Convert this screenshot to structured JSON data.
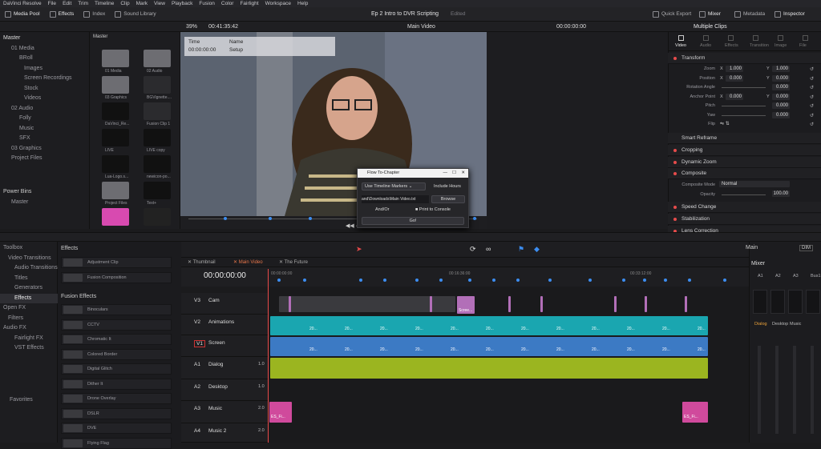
{
  "menubar": [
    "DaVinci Resolve",
    "File",
    "Edit",
    "Trim",
    "Timeline",
    "Clip",
    "Mark",
    "View",
    "Playback",
    "Fusion",
    "Color",
    "Fairlight",
    "Workspace",
    "Help"
  ],
  "toolbar": {
    "media_pool": "Media Pool",
    "effects": "Effects",
    "index": "Index",
    "sound_library": "Sound Library",
    "project_title": "Ep 2 Intro to DVR Scripting",
    "project_status": "Edited",
    "quick_export": "Quick Export",
    "mixer": "Mixer",
    "metadata": "Metadata",
    "inspector": "Inspector"
  },
  "viewer_bar": {
    "zoom": "39%",
    "timecode": "00:41:35:42",
    "viewer_name": "Main Video",
    "playhead_tc": "00:00:00:00",
    "inspector_title": "Multiple Clips"
  },
  "media_tree": {
    "header": "Master",
    "items": [
      "Master",
      "01 Media",
      "BRoll",
      "Images",
      "Screen Recordings",
      "Stock",
      "Videos",
      "02 Audio",
      "Folly",
      "Music",
      "SFX",
      "03 Graphics",
      "Project Files"
    ],
    "power_bins": "Power Bins",
    "power_master": "Master"
  },
  "media_thumbs": {
    "header": "Master",
    "items": [
      "01 Media",
      "02 Audio",
      "03 Graphics",
      "BGVignette....",
      "DaVinci_Re...",
      "Fusion Clip 1",
      "LIVE",
      "LIVE copy",
      "Lua-Logo.s...",
      "newicon-po...",
      "Project Files",
      "Text+"
    ]
  },
  "marker_overlay": {
    "col1": "Time",
    "col2": "Name",
    "val1": "00:00:00:00",
    "val2": "Setup"
  },
  "inspector": {
    "tabs": [
      "Video",
      "Audio",
      "Effects",
      "Transition",
      "Image",
      "File"
    ],
    "transform": "Transform",
    "zoom_label": "Zoom",
    "zoom_x": "1.000",
    "zoom_y": "1.000",
    "position_label": "Position",
    "pos_x": "0.000",
    "pos_y": "0.000",
    "rotation_label": "Rotation Angle",
    "rotation": "0.000",
    "anchor_label": "Anchor Point",
    "anchor_x": "0.000",
    "anchor_y": "0.000",
    "pitch_label": "Pitch",
    "pitch": "0.000",
    "yaw_label": "Yaw",
    "yaw": "0.000",
    "flip_label": "Flip",
    "x": "X",
    "y": "Y",
    "sections": [
      "Smart Reframe",
      "Cropping",
      "Dynamic Zoom",
      "Composite"
    ],
    "composite_mode_label": "Composite Mode",
    "composite_mode": "Normal",
    "opacity_label": "Opacity",
    "opacity": "100.00",
    "sections2": [
      "Speed Change",
      "Stabilization",
      "Lens Correction"
    ]
  },
  "dialog": {
    "title": "Flow To-Chapter",
    "marker_select": "Use Timeline Markers",
    "include_hours": "Include Hours",
    "path": "and\\Downloads\\Main Video.txt",
    "browse": "Browse",
    "and_or": "And/Or",
    "print_console": "Print to Console",
    "go": "Go!"
  },
  "toolbox": {
    "header": "Effects",
    "items": [
      "Toolbox",
      "Video Transitions",
      "Audio Transitions",
      "Titles",
      "Generators",
      "Effects",
      "Open FX",
      "Filters",
      "Audio FX",
      "Fairlight FX",
      "VST Effects"
    ],
    "favorites": "Favorites",
    "fx_top": [
      "Adjustment Clip",
      "Fusion Composition"
    ],
    "fusion_effects": "Fusion Effects",
    "fx_list": [
      "Binoculars",
      "CCTV",
      "Chromatic It",
      "Colored Border",
      "Digital Glitch",
      "Dither It",
      "Drone Overlay",
      "DSLR",
      "DVE",
      "Flying Flag"
    ]
  },
  "timeline": {
    "tabs": [
      "Thumbnail",
      "Main Video",
      "The Future"
    ],
    "timecode": "00:00:00:00",
    "ruler": [
      "00:00:00:00",
      "00:16:36:00",
      "00:33:12:00"
    ],
    "tracks": [
      {
        "id": "V3",
        "name": "Cam"
      },
      {
        "id": "V2",
        "name": "Animations"
      },
      {
        "id": "V1",
        "name": "Screen"
      },
      {
        "id": "A1",
        "name": "Dialog",
        "level": "1.0"
      },
      {
        "id": "A2",
        "name": "Desktop",
        "level": "1.0"
      },
      {
        "id": "A3",
        "name": "Music",
        "level": "2.0"
      },
      {
        "id": "A4",
        "name": "Music 2",
        "level": "2.0"
      }
    ],
    "clip_v3": "Scree...",
    "clip_a3_1": "ES_Fi...",
    "clip_a3_2": "ES_Fi...",
    "clip_num": "20..."
  },
  "mixer": {
    "title": "Mixer",
    "main": "Main",
    "dim": "DIM",
    "channels": [
      "A1",
      "A2",
      "A3",
      "Bus1"
    ],
    "names": [
      "Dialog",
      "Desktop",
      "Music"
    ]
  }
}
